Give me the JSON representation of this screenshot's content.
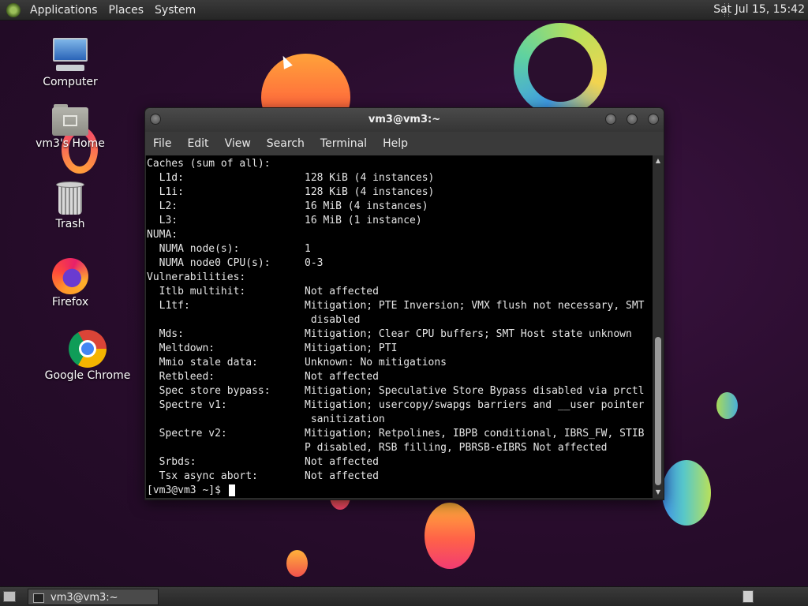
{
  "top_panel": {
    "menus": [
      "Applications",
      "Places",
      "System"
    ],
    "clock": "Sat Jul 15, 15:42"
  },
  "desktop_icons": {
    "computer": "Computer",
    "home": "vm3's Home",
    "trash": "Trash",
    "firefox": "Firefox",
    "chrome": "Google Chrome"
  },
  "window": {
    "title": "vm3@vm3:~",
    "menus": [
      "File",
      "Edit",
      "View",
      "Search",
      "Terminal",
      "Help"
    ]
  },
  "terminal": {
    "lines": [
      {
        "k": "Caches (sum of all):",
        "v": ""
      },
      {
        "k": "  L1d:",
        "v": "128 KiB (4 instances)"
      },
      {
        "k": "  L1i:",
        "v": "128 KiB (4 instances)"
      },
      {
        "k": "  L2:",
        "v": "16 MiB (4 instances)"
      },
      {
        "k": "  L3:",
        "v": "16 MiB (1 instance)"
      },
      {
        "k": "NUMA:",
        "v": ""
      },
      {
        "k": "  NUMA node(s):",
        "v": "1"
      },
      {
        "k": "  NUMA node0 CPU(s):",
        "v": "0-3"
      },
      {
        "k": "Vulnerabilities:",
        "v": ""
      },
      {
        "k": "  Itlb multihit:",
        "v": "Not affected"
      },
      {
        "k": "  L1tf:",
        "v": "Mitigation; PTE Inversion; VMX flush not necessary, SMT"
      },
      {
        "k": "",
        "v": " disabled"
      },
      {
        "k": "  Mds:",
        "v": "Mitigation; Clear CPU buffers; SMT Host state unknown"
      },
      {
        "k": "  Meltdown:",
        "v": "Mitigation; PTI"
      },
      {
        "k": "  Mmio stale data:",
        "v": "Unknown: No mitigations"
      },
      {
        "k": "  Retbleed:",
        "v": "Not affected"
      },
      {
        "k": "  Spec store bypass:",
        "v": "Mitigation; Speculative Store Bypass disabled via prctl"
      },
      {
        "k": "  Spectre v1:",
        "v": "Mitigation; usercopy/swapgs barriers and __user pointer"
      },
      {
        "k": "",
        "v": " sanitization"
      },
      {
        "k": "  Spectre v2:",
        "v": "Mitigation; Retpolines, IBPB conditional, IBRS_FW, STIB"
      },
      {
        "k": "",
        "v": "P disabled, RSB filling, PBRSB-eIBRS Not affected"
      },
      {
        "k": "  Srbds:",
        "v": "Not affected"
      },
      {
        "k": "  Tsx async abort:",
        "v": "Not affected"
      }
    ],
    "prompt": "[vm3@vm3 ~]$ "
  },
  "bottom_panel": {
    "task_label": "vm3@vm3:~"
  }
}
